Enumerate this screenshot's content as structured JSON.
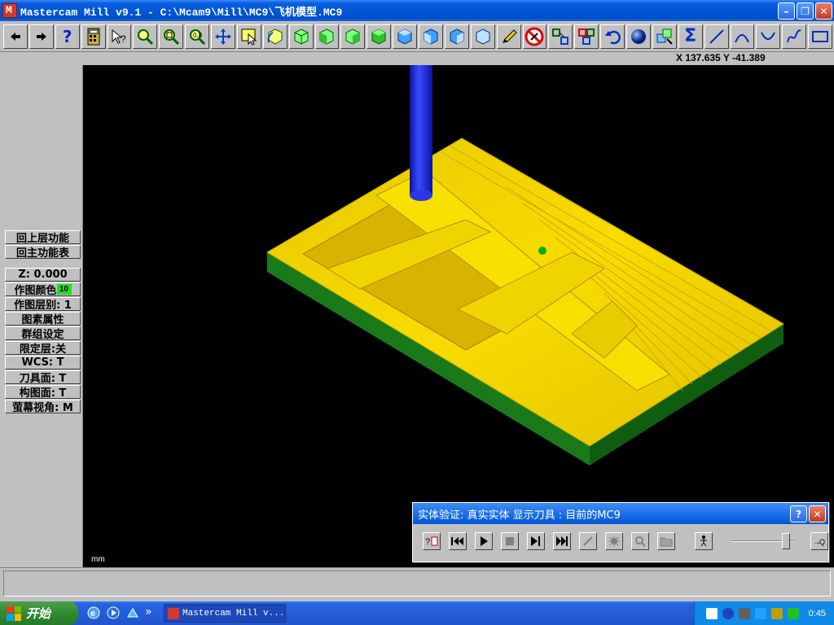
{
  "window": {
    "title": "Mastercam Mill v9.1 - C:\\Mcam9\\Mill\\MC9\\飞机模型.MC9",
    "minimize_label": "–",
    "restore_label": "❐",
    "close_label": "✕"
  },
  "toolbar": {
    "buttons": [
      "arrow-left",
      "arrow-right",
      "help",
      "calculator",
      "context-help",
      "zoom-window",
      "zoom-in",
      "zoom-fit",
      "pan",
      "select",
      "rotate-view",
      "iso-view-1",
      "iso-view-2",
      "iso-view-3",
      "iso-view-4",
      "shaded-view-1",
      "shaded-view-2",
      "shaded-view-3",
      "shaded-view-4",
      "pen",
      "delete",
      "transform-1",
      "transform-2",
      "undo",
      "shaded-sphere",
      "group",
      "sum",
      "line",
      "arc-1",
      "arc-2",
      "spline",
      "rectangle"
    ],
    "help_glyph": "?",
    "sigma_glyph": "Σ"
  },
  "coords": {
    "text": "X 137.635  Y -41.389"
  },
  "left_menu": {
    "items": [
      {
        "label": "回上层功能"
      },
      {
        "label": "回主功能表"
      },
      {
        "label": "Z:  0.000"
      },
      {
        "label": "作图颜色",
        "chip": "10"
      },
      {
        "label": "作图层别: 1"
      },
      {
        "label": "图素属性"
      },
      {
        "label": "群组设定"
      },
      {
        "label": "限定层:关"
      },
      {
        "label": "WCS:  T"
      },
      {
        "label": "刀具面: T"
      },
      {
        "label": "构图面: T"
      },
      {
        "label": "萤幕视角: M"
      }
    ]
  },
  "viewport": {
    "unit": "mm",
    "colors": {
      "stock_top": "#f0d000",
      "stock_side": "#1a7a1a",
      "tool": "#1a2acc",
      "background": "#000000"
    }
  },
  "verify_dialog": {
    "title": "实体验证: 真实实体  显示刀具  : 目前的MC9",
    "help_label": "?",
    "close_label": "✕",
    "controls": [
      "options",
      "rewind",
      "play",
      "stop",
      "step",
      "fast-forward",
      "toggle-tool",
      "toggle-stock",
      "zoom",
      "save",
      "walk"
    ],
    "speed_level": 0.92
  },
  "taskbar": {
    "start_label": "开始",
    "task_label": "Mastercam Mill v...",
    "overflow_label": "»",
    "clock": "0:45"
  }
}
